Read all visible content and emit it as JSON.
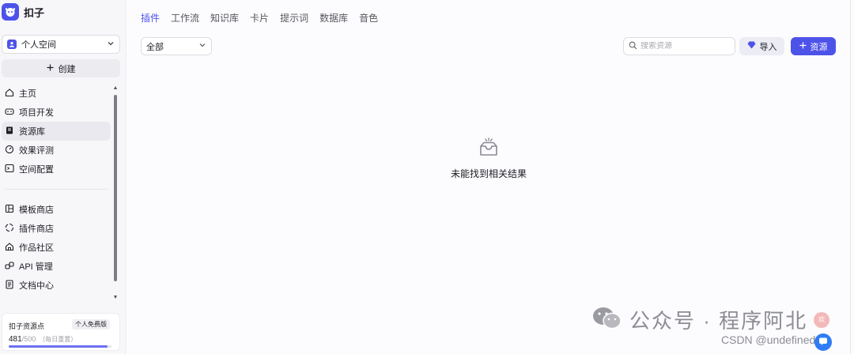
{
  "app": {
    "name": "扣子"
  },
  "workspace": {
    "selected": "个人空间"
  },
  "sidebar": {
    "create_label": "创建",
    "items": [
      {
        "label": "主页",
        "icon": "home-icon"
      },
      {
        "label": "项目开发",
        "icon": "gamepad-icon"
      },
      {
        "label": "资源库",
        "icon": "book-icon",
        "active": true
      },
      {
        "label": "效果评测",
        "icon": "gauge-icon"
      },
      {
        "label": "空间配置",
        "icon": "terminal-icon"
      }
    ],
    "items2": [
      {
        "label": "模板商店",
        "icon": "template-icon"
      },
      {
        "label": "插件商店",
        "icon": "plugin-icon"
      },
      {
        "label": "作品社区",
        "icon": "community-icon"
      },
      {
        "label": "API 管理",
        "icon": "link-icon"
      },
      {
        "label": "文档中心",
        "icon": "document-icon"
      }
    ],
    "points": {
      "title": "扣子资源点",
      "plan": "个人免费版",
      "used": "481",
      "total": "/500",
      "reset": "（每日重置）",
      "progress": 0.962
    }
  },
  "tabs": [
    "插件",
    "工作流",
    "知识库",
    "卡片",
    "提示词",
    "数据库",
    "音色"
  ],
  "active_tab": 0,
  "toolbar": {
    "filter": "全部",
    "search_placeholder": "搜索资源",
    "import_label": "导入",
    "resource_label": "资源"
  },
  "empty_state": {
    "text": "未能找到相关结果"
  },
  "watermark": {
    "text": "公众号 · 程序阿北",
    "badge": "欢",
    "csdn": "CSDN @undefined"
  },
  "colors": {
    "accent": "#4d53e8",
    "sidebar_bg": "#f7f7fa"
  }
}
